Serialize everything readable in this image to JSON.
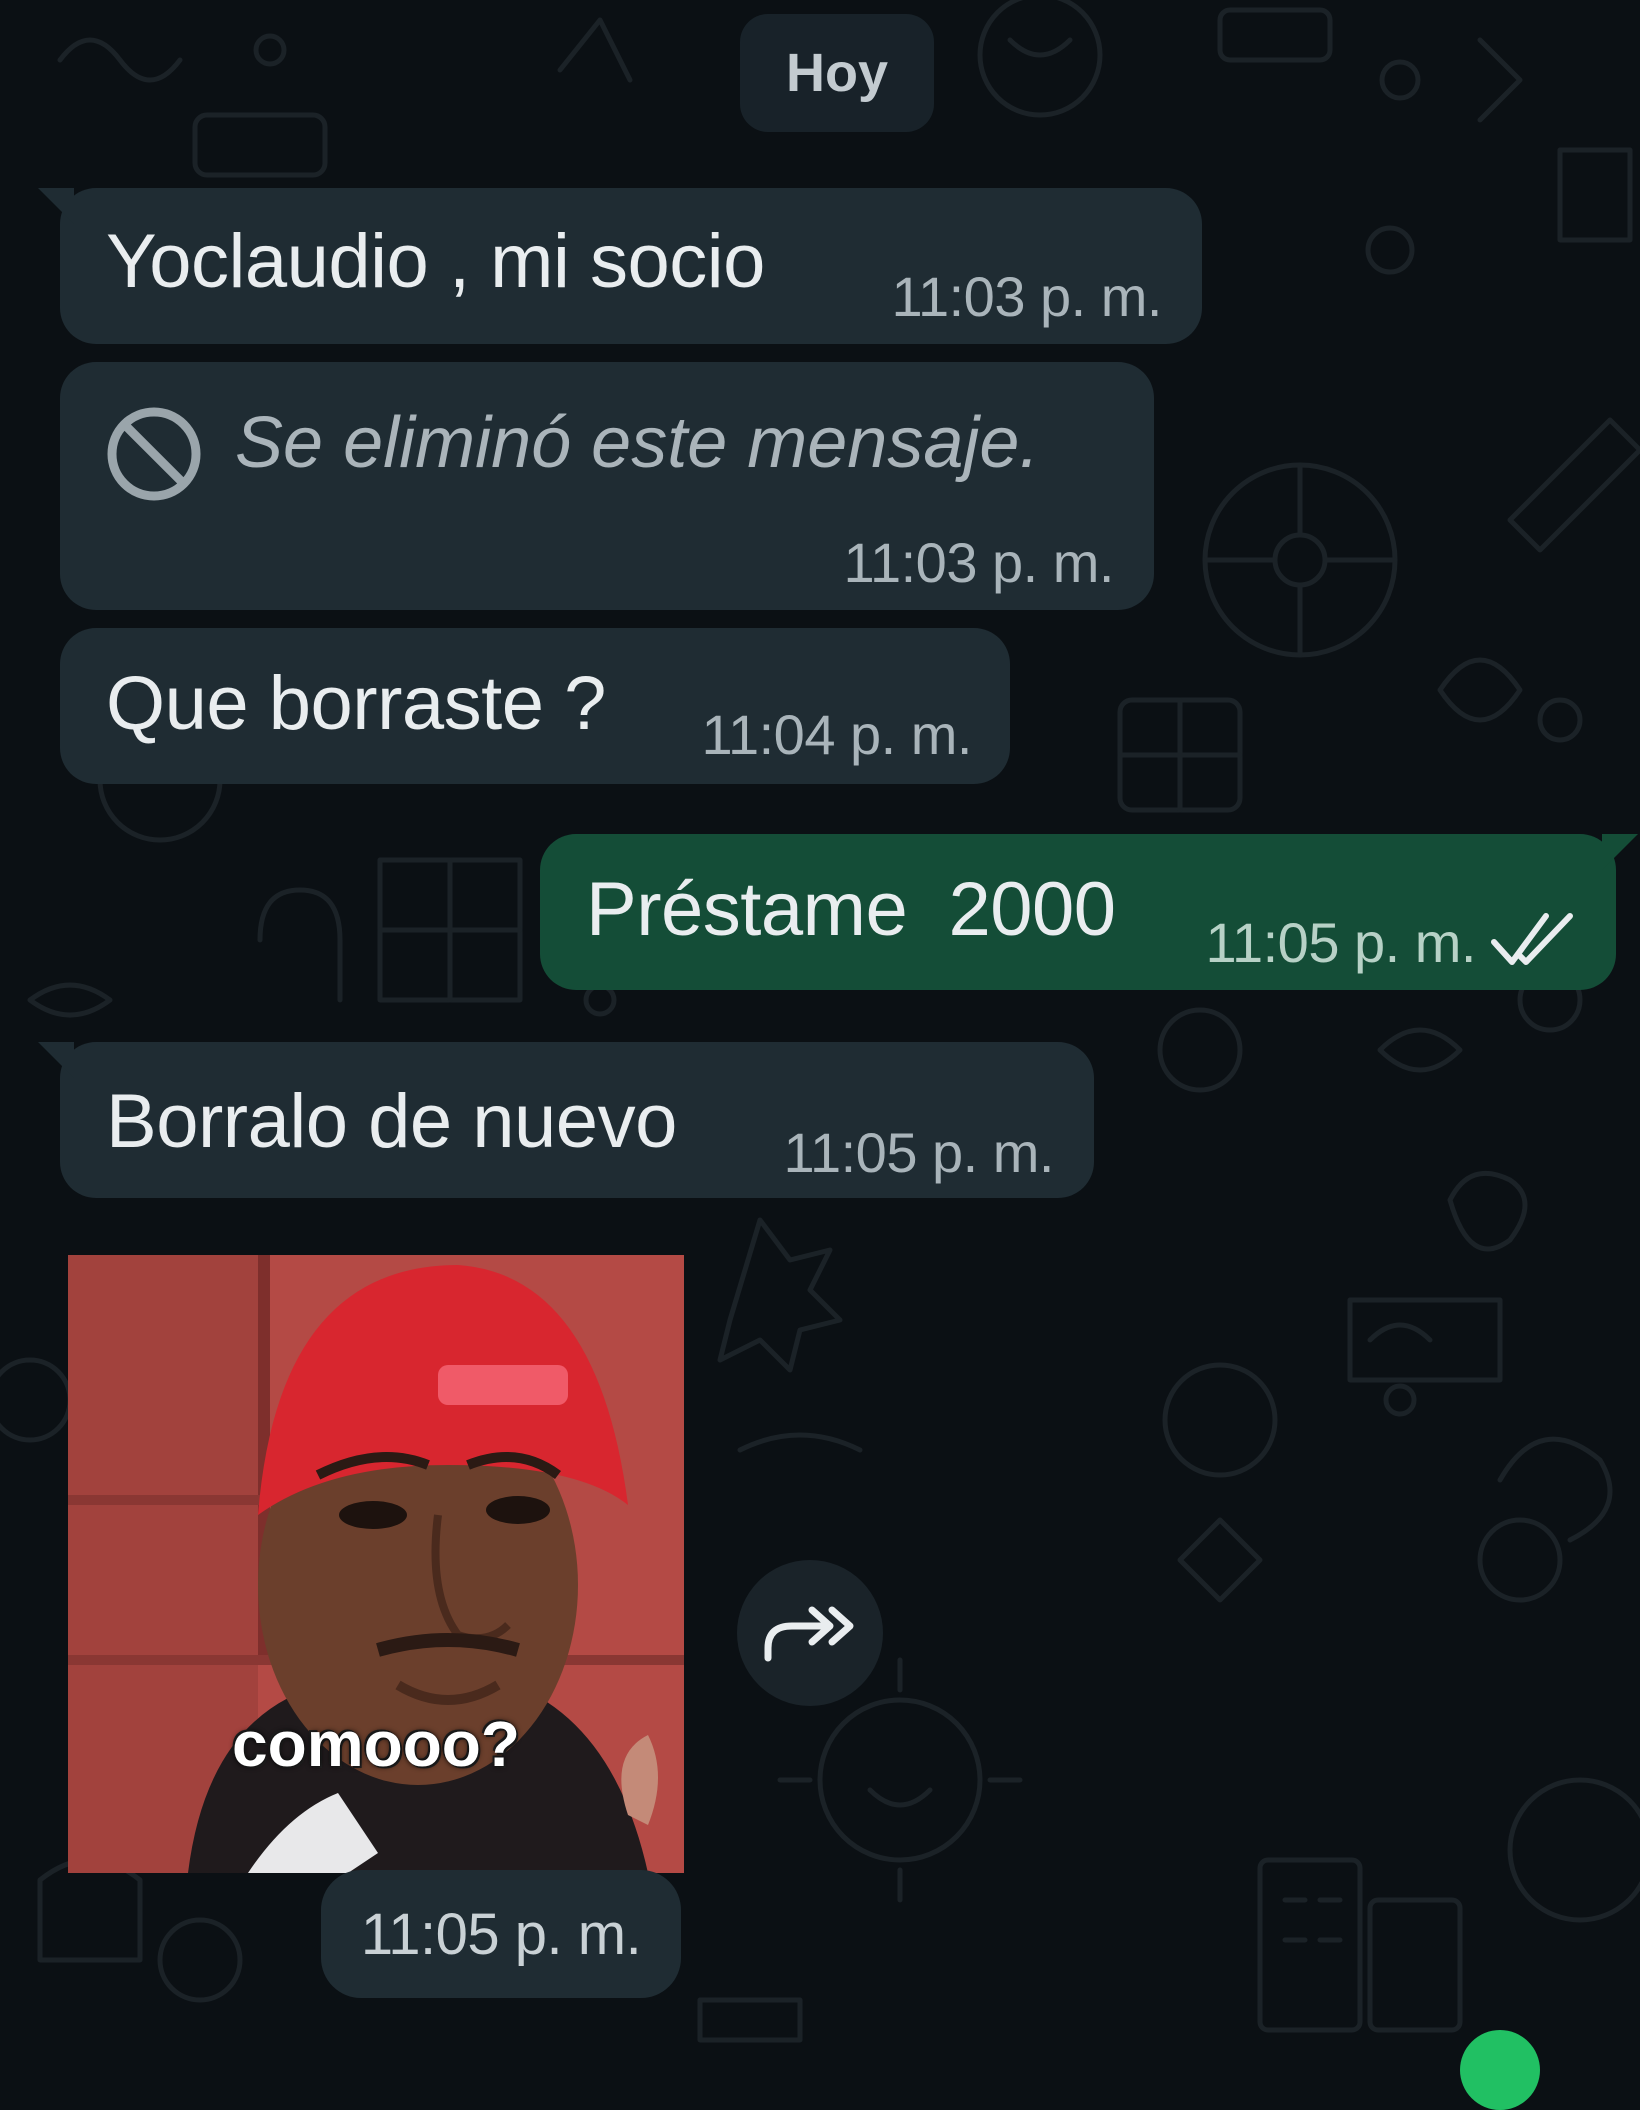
{
  "date_divider": "Hoy",
  "messages": [
    {
      "direction": "in",
      "text": "Yoclaudio , mi socio",
      "time": "11:03 p. m."
    },
    {
      "direction": "in",
      "deleted": true,
      "text": "Se eliminó este mensaje.",
      "time": "11:03 p. m."
    },
    {
      "direction": "in",
      "text": "Que borraste ?",
      "time": "11:04 p. m."
    },
    {
      "direction": "out",
      "text": "Préstame  2000",
      "time": "11:05 p. m.",
      "status": "read-double-check"
    },
    {
      "direction": "in",
      "text": "Borralo de nuevo",
      "time": "11:05 p. m."
    }
  ],
  "sticker": {
    "caption": "comooo?",
    "time": "11:05 p. m.",
    "forward_icon": "forward-double-arrow-icon"
  },
  "colors": {
    "background": "#0b1014",
    "incoming_bubble": "#1f2c33",
    "outgoing_bubble": "#144d37",
    "text": "#e9edef",
    "timestamp": "#a9b4ba",
    "read_tick": "#e9edef",
    "accent_green": "#21c063"
  }
}
